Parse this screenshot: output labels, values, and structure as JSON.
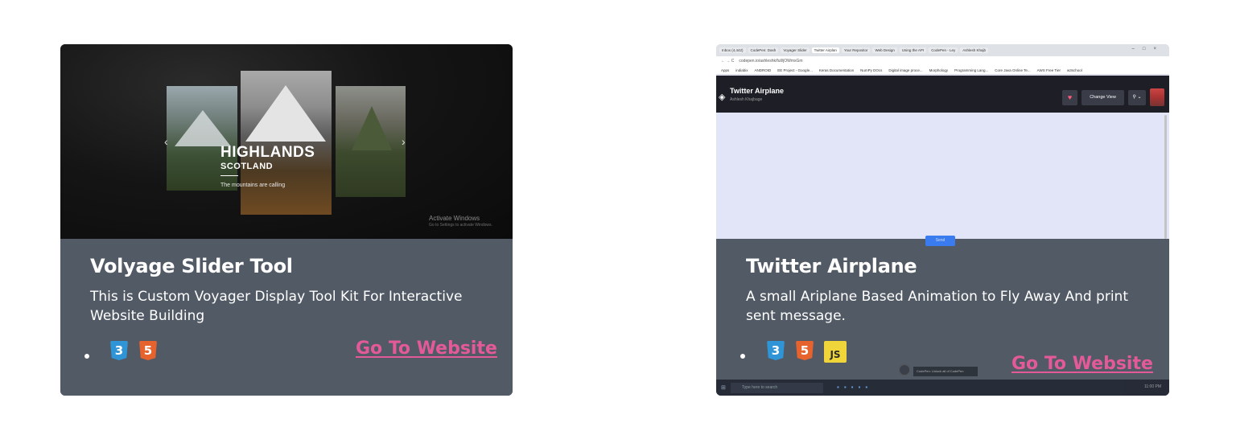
{
  "cards": [
    {
      "title": "Volyage Slider Tool",
      "description": "This is Custom Voyager Display Tool Kit For Interactive Website Building",
      "link_label": "Go To Website",
      "tech_icons": [
        "css3-icon",
        "html5-icon"
      ],
      "preview": {
        "heading": "HIGHLANDS",
        "subheading": "SCOTLAND",
        "tagline": "The mountains are calling",
        "prev_arrow": "‹",
        "next_arrow": "›",
        "watermark_title": "Activate Windows",
        "watermark_sub": "Go to Settings to activate Windows."
      }
    },
    {
      "title": "Twitter Airplane",
      "description": "A small Ariplane Based Animation to Fly Away And print sent message.",
      "link_label": "Go To Website",
      "tech_icons": [
        "css3-icon",
        "html5-icon",
        "js-icon"
      ],
      "js_label": "JS",
      "preview": {
        "tabs": [
          "Inbox (4,442)",
          "CodePen: Dash",
          "Voyager Slider",
          "Twitter Airplan",
          "Your Repositor",
          "Web Design",
          "Using the API",
          "CodePen - Ley",
          "Ashlesh Khajb"
        ],
        "url": "codepen.io/ashleshk/full/jOWmxGm",
        "bookmarks": [
          "Apps",
          "indiabix",
          "ANDROID",
          "EE Project - Google...",
          "Keras Documentation",
          "NumPy DOcs",
          "Digital image proce...",
          "Morphology",
          "Programming Lang...",
          "Core Java Online Te...",
          "AWS Free Tier",
          "w3school"
        ],
        "pen_title": "Twitter Airplane",
        "pen_author": "Ashlesh Khajbage",
        "change_view": "Change View",
        "send_label": "Send",
        "taskbar_search": "Type here to search",
        "toast_text": "CodePen: Unlock all of CodePen",
        "tray_time": "11:00 PM",
        "tray_date": "15-Jan-2021"
      }
    }
  ],
  "colors": {
    "card_bg": "#525a66",
    "link": "#e45a98",
    "css": "#2f95d6",
    "html": "#e7632d",
    "js": "#f0d53a"
  }
}
